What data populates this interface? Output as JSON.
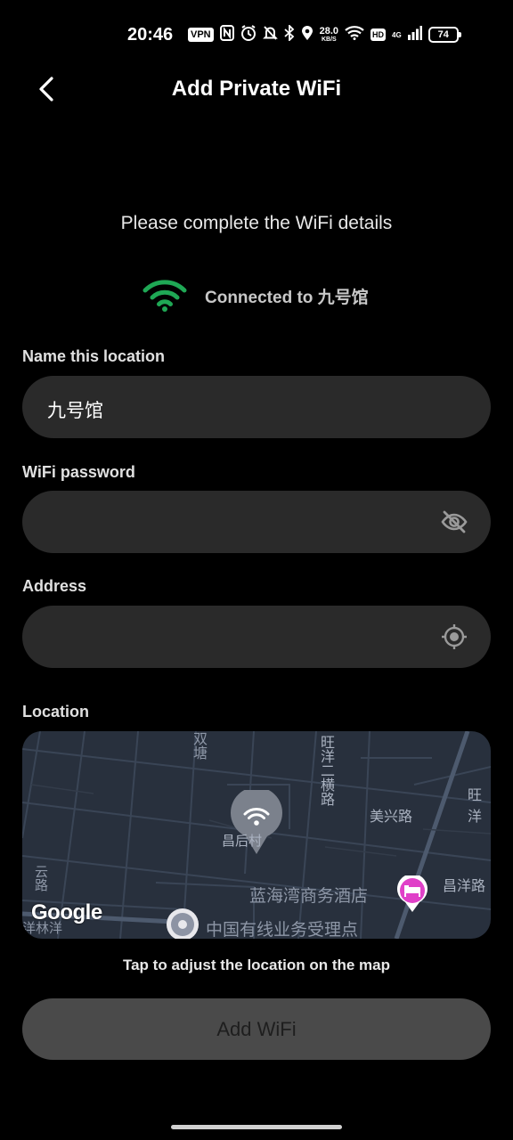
{
  "status_bar": {
    "time": "20:46",
    "vpn": "VPN",
    "speed_value": "28.0",
    "speed_unit": "KB/S",
    "hd": "HD",
    "network": "4G",
    "battery": "74",
    "icons": [
      "nfc-icon",
      "alarm-icon",
      "mute-icon",
      "bluetooth-icon",
      "location-icon",
      "wifi-icon",
      "signal-icon"
    ]
  },
  "header": {
    "title": "Add Private WiFi"
  },
  "subtitle": "Please complete the WiFi details",
  "connection": {
    "text": "Connected to 九号馆",
    "icon_color": "#1fa855"
  },
  "form": {
    "name_label": "Name this location",
    "name_value": "九号馆",
    "password_label": "WiFi password",
    "password_value": "",
    "address_label": "Address",
    "address_value": "",
    "location_label": "Location"
  },
  "map": {
    "labels": {
      "road_1": "双塘",
      "road_2": "旺洋二横路",
      "road_3": "美兴路",
      "road_4": "旺洋",
      "road_5": "昌洋路",
      "road_6": "云路",
      "road_7": "洋林洋",
      "village": "昌后村",
      "hotel": "蓝海湾商务酒店",
      "cable_office": "中国有线业务受理点",
      "brand": "Google"
    },
    "hint": "Tap to adjust the location on the map"
  },
  "add_button": "Add WiFi",
  "colors": {
    "background": "#000000",
    "field": "#2a2a2a",
    "button": "#4a4a4a",
    "map": "#28303d",
    "hotel_pin": "#e040c8"
  }
}
